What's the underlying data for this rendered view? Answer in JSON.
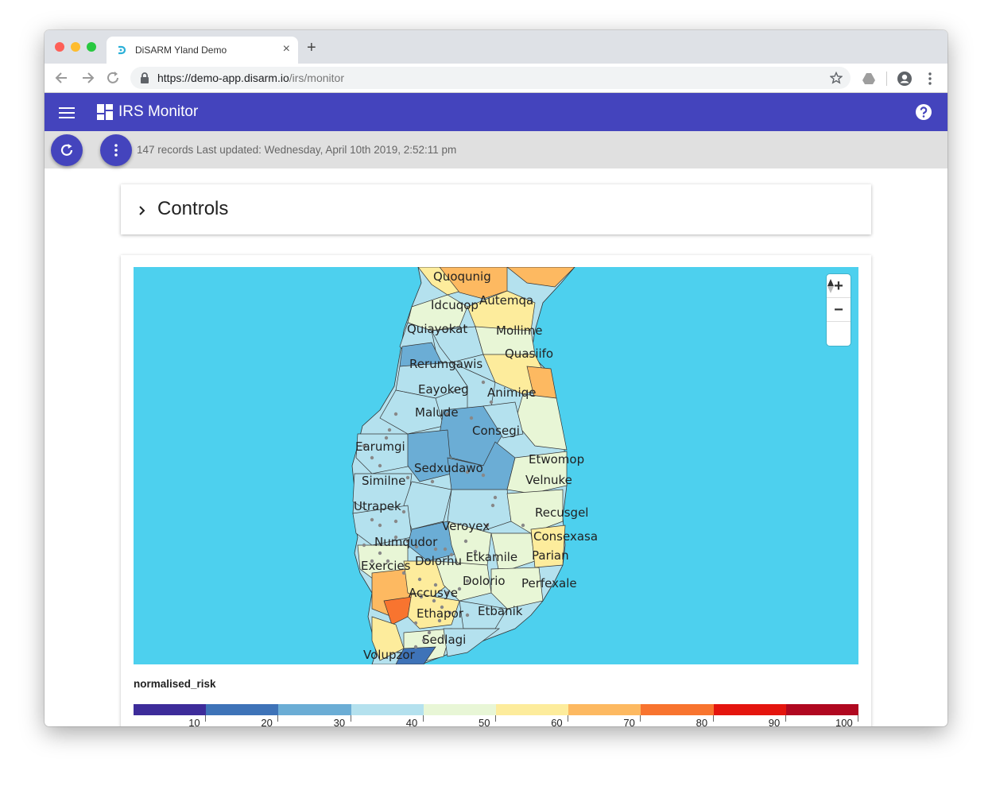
{
  "browser": {
    "tab_title": "DiSARM Yland Demo",
    "url_host": "https://demo-app.disarm.io",
    "url_path": "/irs/monitor",
    "new_tab_symbol": "+",
    "close_symbol": "×"
  },
  "app": {
    "title": "IRS Monitor",
    "accent_color": "#4444bd"
  },
  "status": {
    "text": "147 records Last updated: Wednesday, April 10th 2019, 2:52:11 pm"
  },
  "controls": {
    "label": "Controls"
  },
  "map": {
    "sea_color": "#4dd0ee",
    "zoom_in": "+",
    "zoom_out": "−",
    "region_labels": [
      "Quoqunig",
      "Idcuqop",
      "Autemqa",
      "Quiayokat",
      "Mollime",
      "Quasiifo",
      "Rerumgawis",
      "Eayokeg",
      "Animiqe",
      "Malude",
      "Consegi",
      "Earumgi",
      "Etwomop",
      "Sedxudawo",
      "Similne",
      "Velnuke",
      "Utrapek",
      "Recusgel",
      "Veroyex",
      "Consexasa",
      "Numqudor",
      "Parian",
      "Dolorhu",
      "Etkamile",
      "Exercies",
      "Dolorio",
      "Perfexale",
      "Accusye",
      "Ethapor",
      "Etbanik",
      "Sedlagi",
      "Volupzor"
    ]
  },
  "legend": {
    "title": "normalised_risk",
    "colors": [
      "#3d2c9a",
      "#3e73b8",
      "#6badd5",
      "#b4e1ee",
      "#e8f6d6",
      "#fdec9c",
      "#fdb961",
      "#f8742f",
      "#e4150e",
      "#b00820"
    ],
    "ticks": [
      "10",
      "20",
      "30",
      "40",
      "50",
      "60",
      "70",
      "80",
      "90",
      "100"
    ]
  }
}
